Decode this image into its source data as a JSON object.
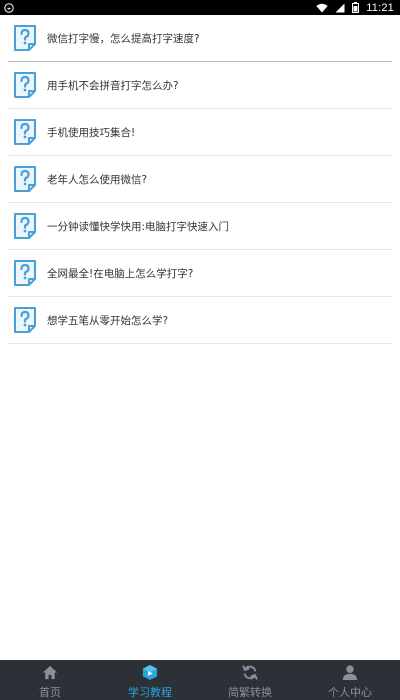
{
  "status_bar": {
    "time": "11:21",
    "left_icon": "android-debug-icon",
    "icons": [
      "wifi-icon",
      "signal-icon",
      "battery-icon"
    ]
  },
  "articles": [
    {
      "title": "微信打字慢，怎么提高打字速度?",
      "icon": "question-document-icon"
    },
    {
      "title": "用手机不会拼音打字怎么办?",
      "icon": "question-document-icon"
    },
    {
      "title": "手机使用技巧集合!",
      "icon": "question-document-icon"
    },
    {
      "title": "老年人怎么使用微信?",
      "icon": "question-document-icon"
    },
    {
      "title": "一分钟读懂快学快用:电脑打字快速入门",
      "icon": "question-document-icon"
    },
    {
      "title": "全网最全!在电脑上怎么学打字?",
      "icon": "question-document-icon"
    },
    {
      "title": "想学五笔从零开始怎么学?",
      "icon": "question-document-icon"
    }
  ],
  "bottom_nav": {
    "items": [
      {
        "label": "首页",
        "icon": "home-icon",
        "active": false
      },
      {
        "label": "学习教程",
        "icon": "tutorial-cube-icon",
        "active": true
      },
      {
        "label": "简繁转换",
        "icon": "refresh-icon",
        "active": false
      },
      {
        "label": "个人中心",
        "icon": "user-icon",
        "active": false
      }
    ]
  },
  "colors": {
    "accent": "#2aa3e0",
    "nav_background": "#2c3138",
    "nav_inactive": "#8b9097",
    "icon_blue": "#4a9fd6"
  }
}
